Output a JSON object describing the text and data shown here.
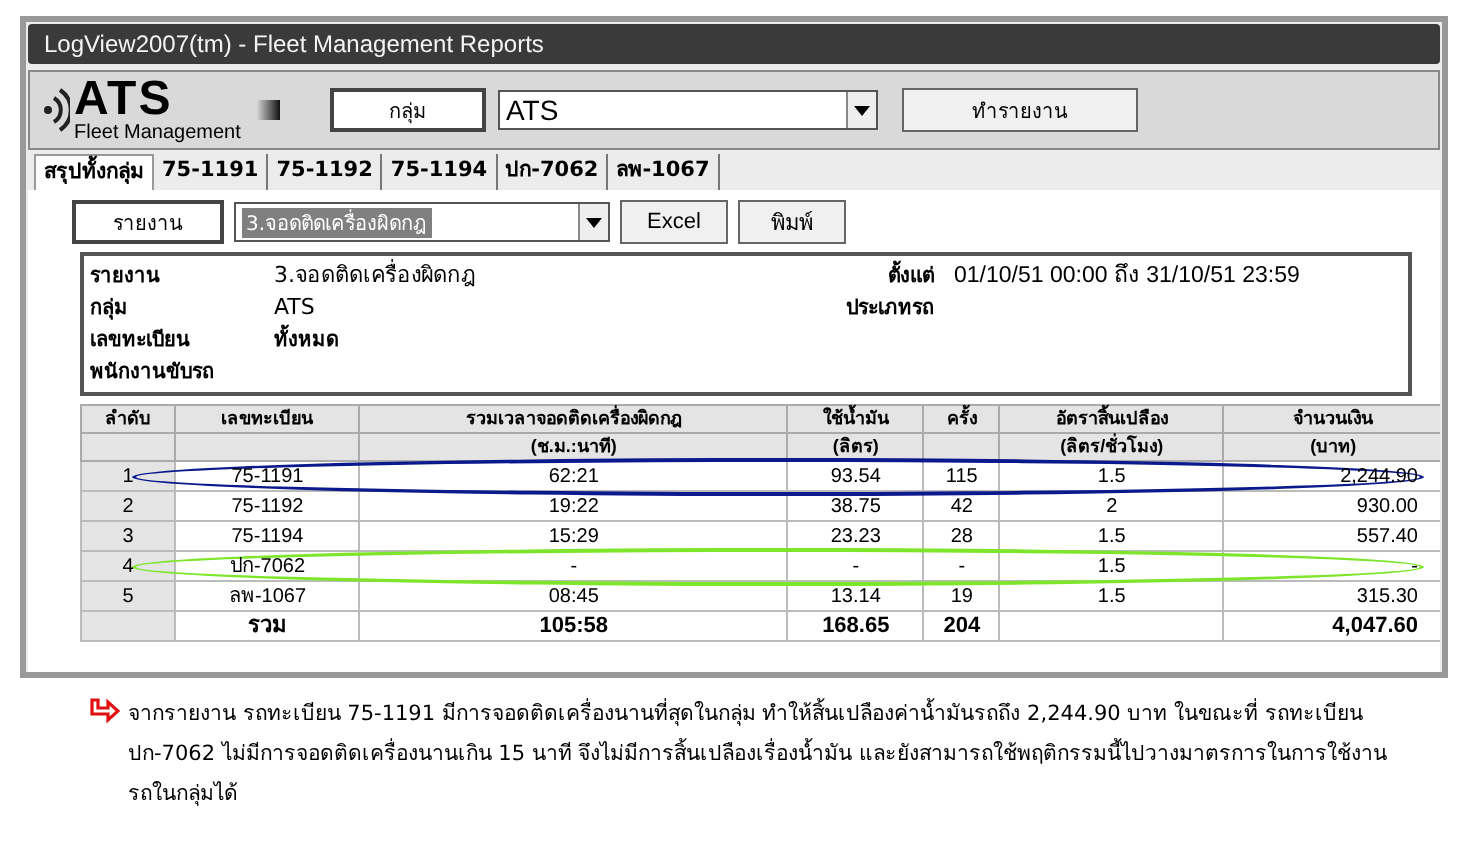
{
  "window": {
    "title": "LogView2007(tm)  - Fleet Management Reports"
  },
  "toolbar": {
    "logo_text": "ATS",
    "logo_subtitle": "Fleet Management",
    "group_label": "กลุ่ม",
    "group_value": "ATS",
    "run_button": "ทำรายงาน"
  },
  "tabs": [
    {
      "label": "สรุปทั้งกลุ่ม",
      "selected": true
    },
    {
      "label": "75-1191",
      "selected": false
    },
    {
      "label": "75-1192",
      "selected": false
    },
    {
      "label": "75-1194",
      "selected": false
    },
    {
      "label": "ปก-7062",
      "selected": false
    },
    {
      "label": "ลพ-1067",
      "selected": false
    }
  ],
  "report_bar": {
    "label": "รายงาน",
    "value": "3.จอดติดเครื่องผิดกฎ",
    "buttons": [
      "Excel",
      "พิมพ์"
    ]
  },
  "info": {
    "left": [
      {
        "label": "รายงาน",
        "value": "3.จอดติดเครื่องผิดกฎ",
        "bold": false
      },
      {
        "label": "กลุ่ม",
        "value": "ATS",
        "bold": false
      },
      {
        "label": "เลขทะเบียน",
        "value": "ทั้งหมด",
        "bold": true
      },
      {
        "label": "พนักงานขับรถ"
      }
    ],
    "right": [
      {
        "label": "ตั้งแต่",
        "value": "01/10/51  00:00 ถึง 31/10/51  23:59"
      },
      {
        "label": "ประเภทรถ"
      }
    ]
  },
  "table": {
    "columns": [
      {
        "label": "ลำดับ"
      },
      {
        "label": "เลขทะเบียน"
      },
      {
        "label": "รวมเวลาจอดติดเครื่องผิดกฎ",
        "unit": "(ช.ม.:นาที)"
      },
      {
        "label": "ใช้น้ำมัน",
        "unit": "(ลิตร)"
      },
      {
        "label": "ครั้ง"
      },
      {
        "label": "อัตราสิ้นเปลือง",
        "unit": "(ลิตร/ชั่วโมง)"
      },
      {
        "label": "จำนวนเงิน",
        "unit": "(บาท)"
      }
    ],
    "rows": [
      {
        "cells": [
          "1",
          "75-1191",
          "62:21",
          "93.54",
          "115",
          "1.5",
          "2,244.90"
        ],
        "color": "#0a1a8c"
      },
      {
        "cells": [
          "2",
          "75-1192",
          "19:22",
          "38.75",
          "42",
          "2",
          "930.00"
        ]
      },
      {
        "cells": [
          "3",
          "75-1194",
          "15:29",
          "23.23",
          "28",
          "1.5",
          "557.40"
        ]
      },
      {
        "cells": [
          "4",
          "ปก-7062",
          "-",
          "-",
          "-",
          "1.5",
          "-"
        ],
        "color": "#7ee62a"
      },
      {
        "cells": [
          "5",
          "ลพ-1067",
          "08:45",
          "13.14",
          "19",
          "1.5",
          "315.30"
        ]
      }
    ],
    "total": {
      "label": "รวม",
      "idle_time": "105:58",
      "fuel": "168.65",
      "times": "204",
      "amount": "4,047.60"
    }
  },
  "caption": "จากรายงาน รถทะเบียน 75-1191 มีการจอดติดเครื่องนานที่สุดในกลุ่ม ทำให้สิ้นเปลืองค่าน้ำมันรถถึง 2,244.90 บาท ในขณะที่ รถทะเบียน ปก-7062 ไม่มีการจอดติดเครื่องนานเกิน 15 นาที จึงไม่มีการสิ้นเปลืองเรื่องน้ำมัน และยังสามารถใช้พฤติกรรมนี้ไปวางมาตรการในการใช้งานรถในกลุ่มได้"
}
